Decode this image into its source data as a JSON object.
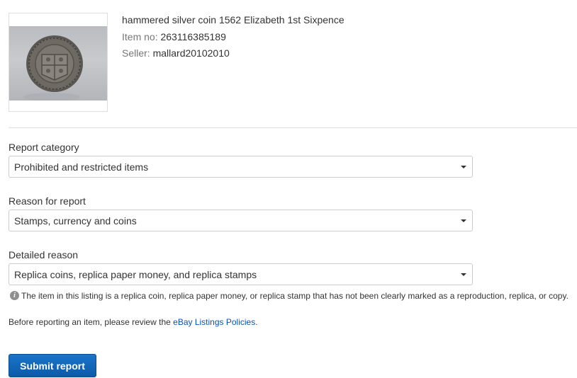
{
  "item": {
    "title": "hammered silver coin 1562 Elizabeth 1st Sixpence",
    "item_no_label": "Item no:",
    "item_no": "263116385189",
    "seller_label": "Seller:",
    "seller": "mallard20102010"
  },
  "form": {
    "category": {
      "label": "Report category",
      "value": "Prohibited and restricted items"
    },
    "reason": {
      "label": "Reason for report",
      "value": "Stamps, currency and coins"
    },
    "detailed": {
      "label": "Detailed reason",
      "value": "Replica coins, replica paper money, and replica stamps",
      "info": "The item in this listing is a replica coin, replica paper money, or replica stamp that has not been clearly marked as a reproduction, replica, or copy."
    },
    "policy_note_before": "Before reporting an item, please review the",
    "policy_link": "eBay Listings Policies",
    "policy_note_after": ".",
    "submit_label": "Submit report"
  },
  "colors": {
    "link": "#0654ba",
    "button": "#0c5aa8",
    "divider": "#dddddd"
  },
  "icons": {
    "info": "info-icon",
    "dropdown": "chevron-down-icon"
  }
}
